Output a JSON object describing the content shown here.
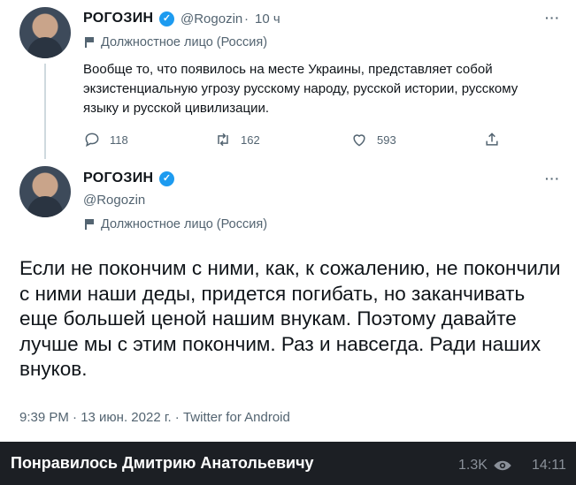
{
  "tweet1": {
    "name": "РОГОЗИН",
    "handle": "@Rogozin",
    "separator": "·",
    "time": "10 ч",
    "label": "Должностное лицо (Россия)",
    "more": "···",
    "text": "Вообще то, что появилось на месте Украины, представляет собой экзистенциальную угрозу русскому народу, русской истории, русскому языку и русской цивилизации.",
    "replies": "118",
    "retweets": "162",
    "likes": "593"
  },
  "tweet2": {
    "name": "РОГОЗИН",
    "handle": "@Rogozin",
    "label": "Должностное лицо (Россия)",
    "more": "···",
    "text": "Если не покончим с ними, как, к сожалению, не покончили с ними наши деды, придется погибать, но заканчивать еще большей ценой нашим внукам. Поэтому давайте лучше мы с этим покончим. Раз и навсегда. Ради наших внуков.",
    "meta": "9:39 PM · 13 июн. 2022 г. · Twitter for Android"
  },
  "telegram": {
    "caption": "Понравилось Дмитрию Анатольевичу",
    "views": "1.3K",
    "time": "14:11"
  },
  "colors": {
    "verified": "#1d9bf0",
    "secondary_text": "#536471",
    "bar_bg": "#1c1f24"
  },
  "icons": [
    "reply-icon",
    "retweet-icon",
    "like-icon",
    "share-icon",
    "verified-icon",
    "flag-icon",
    "eye-icon"
  ]
}
